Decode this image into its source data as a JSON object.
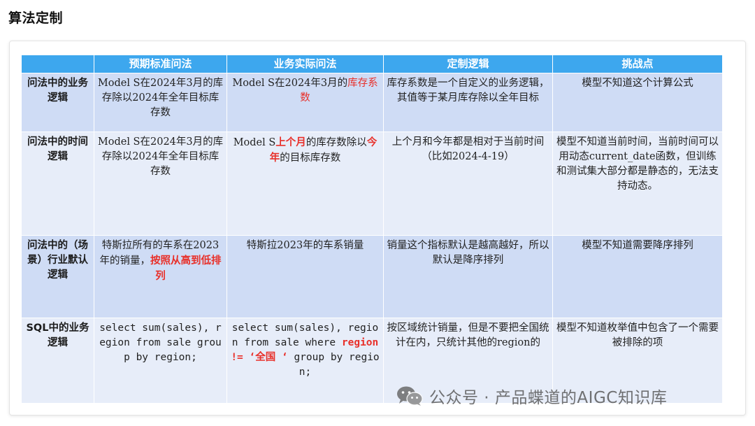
{
  "page": {
    "title": "算法定制"
  },
  "table": {
    "headers": [
      "",
      "预期标准问法",
      "业务实际问法",
      "定制逻辑",
      "挑战点"
    ],
    "rows": [
      {
        "label": "问法中的业务逻辑",
        "standard": "Model S在2024年3月的库存除以2024年全年目标库存数",
        "actual_pre": "Model S在2024年3月的",
        "actual_hl": "库存系数",
        "logic": "库存系数是一个自定义的业务逻辑，其值等于某月库存除以全年目标",
        "challenge": "模型不知道这个计算公式"
      },
      {
        "label": "问法中的时间逻辑",
        "standard": "Model S在2024年3月的库存除以2024年全年目标库存数",
        "actual_pre": "Model S",
        "actual_hl1": "上个月",
        "actual_mid": "的库存数除以",
        "actual_hl2": "今年",
        "actual_post": "的目标库存数",
        "logic": "上个月和今年都是相对于当前时间（比如2024-4-19）",
        "challenge": "模型不知道当前时间，当前时间可以用动态current_date函数，但训练和测试集大部分都是静态的，无法支持动态。"
      },
      {
        "label": "问法中的（场景）行业默认逻辑",
        "standard_pre": "特斯拉所有的车系在2023年的销量，",
        "standard_hl": "按照从高到低排列",
        "actual": "特斯拉2023年的车系销量",
        "logic": "销量这个指标默认是越高越好，所以默认是降序排列",
        "challenge": "模型不知道需要降序排列"
      },
      {
        "label": "SQL中的业务逻辑",
        "standard": "select sum(sales), region from sale group by region;",
        "actual_pre": "select sum(sales), region from sale where ",
        "actual_hl": "region != ‘全国 ‘",
        "actual_post": " group by region;",
        "logic": "按区域统计销量，但是不要把全国统计在内，只统计其他的region的",
        "challenge": "模型不知道枚举值中包含了一个需要被排除的项"
      }
    ]
  },
  "watermark": {
    "icon": "wechat-icon",
    "text": "公众号 · 产品蝶道的AIGC知识库"
  },
  "colors": {
    "header_bg": "#3da7ee",
    "band_a": "#cfdcf5",
    "band_b": "#e7edf9",
    "highlight": "#e8302a"
  }
}
